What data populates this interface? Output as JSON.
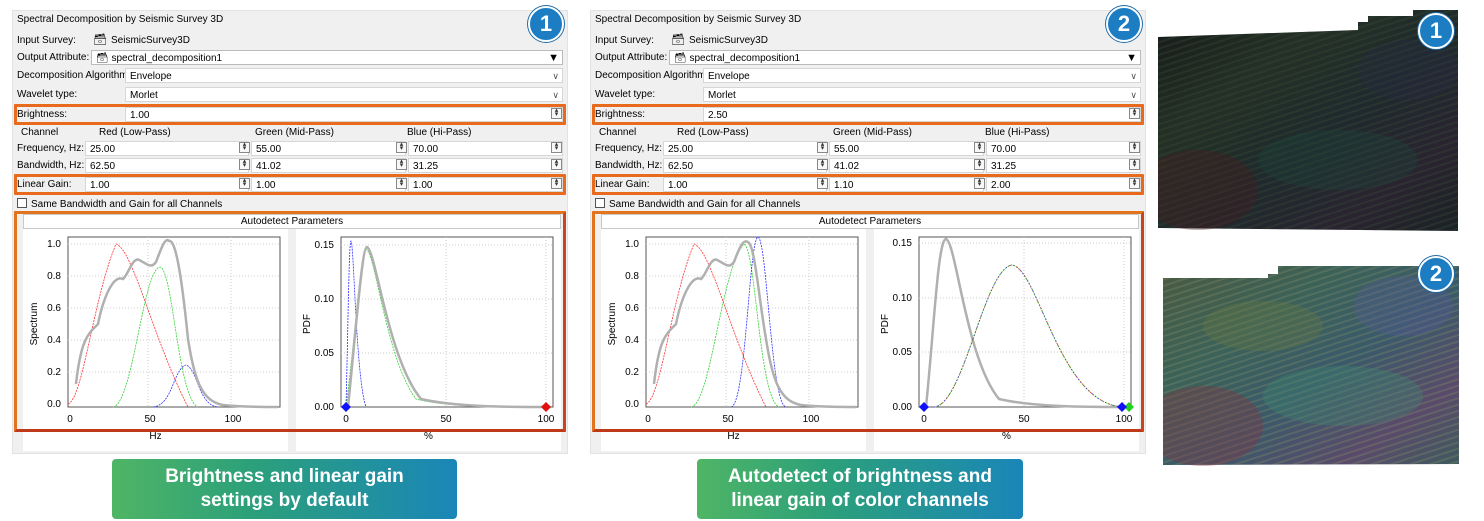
{
  "panels": [
    {
      "title": "Spectral Decomposition by Seismic Survey 3D",
      "badge": "1",
      "input_survey_label": "Input Survey:",
      "input_survey_value": "SeismicSurvey3D",
      "output_attr_label": "Output Attribute:",
      "output_attr_value": "spectral_decomposition1",
      "algo_label": "Decomposition Algorithm:",
      "algo_value": "Envelope",
      "wavelet_label": "Wavelet type:",
      "wavelet_value": "Morlet",
      "brightness_label": "Brightness:",
      "brightness_value": "1.00",
      "channel_hdr": "Channel",
      "red_hdr": "Red (Low-Pass)",
      "green_hdr": "Green (Mid-Pass)",
      "blue_hdr": "Blue (Hi-Pass)",
      "freq_label": "Frequency, Hz:",
      "freq": [
        "25.00",
        "55.00",
        "70.00"
      ],
      "bw_label": "Bandwidth, Hz:",
      "bw": [
        "62.50",
        "41.02",
        "31.25"
      ],
      "gain_label": "Linear Gain:",
      "gain": [
        "1.00",
        "1.00",
        "1.00"
      ],
      "same_bw_label": "Same Bandwidth and Gain for all Channels",
      "autodetect_label": "Autodetect Parameters",
      "spectrum_ylabel": "Spectrum",
      "spectrum_xlabel": "Hz",
      "spectrum_yticks": [
        "1.0",
        "0.8",
        "0.6",
        "0.4",
        "0.2",
        "0.0"
      ],
      "spectrum_xticks": [
        "0",
        "50",
        "100"
      ],
      "pdf_ylabel": "PDF",
      "pdf_xlabel": "%",
      "pdf_yticks": [
        "0.15",
        "0.10",
        "0.05",
        "0.00"
      ],
      "pdf_xticks": [
        "0",
        "50",
        "100"
      ],
      "banner": [
        "Brightness and linear gain",
        "settings by default"
      ]
    },
    {
      "title": "Spectral Decomposition by Seismic Survey 3D",
      "badge": "2",
      "input_survey_label": "Input Survey:",
      "input_survey_value": "SeismicSurvey3D",
      "output_attr_label": "Output Attribute:",
      "output_attr_value": "spectral_decomposition1",
      "algo_label": "Decomposition Algorithm:",
      "algo_value": "Envelope",
      "wavelet_label": "Wavelet type:",
      "wavelet_value": "Morlet",
      "brightness_label": "Brightness:",
      "brightness_value": "2.50",
      "channel_hdr": "Channel",
      "red_hdr": "Red (Low-Pass)",
      "green_hdr": "Green (Mid-Pass)",
      "blue_hdr": "Blue (Hi-Pass)",
      "freq_label": "Frequency, Hz:",
      "freq": [
        "25.00",
        "55.00",
        "70.00"
      ],
      "bw_label": "Bandwidth, Hz:",
      "bw": [
        "62.50",
        "41.02",
        "31.25"
      ],
      "gain_label": "Linear Gain:",
      "gain": [
        "1.00",
        "1.10",
        "2.00"
      ],
      "same_bw_label": "Same Bandwidth and Gain for all Channels",
      "autodetect_label": "Autodetect Parameters",
      "spectrum_ylabel": "Spectrum",
      "spectrum_xlabel": "Hz",
      "spectrum_yticks": [
        "1.0",
        "0.8",
        "0.6",
        "0.4",
        "0.2",
        "0.0"
      ],
      "spectrum_xticks": [
        "0",
        "50",
        "100"
      ],
      "pdf_ylabel": "PDF",
      "pdf_xlabel": "%",
      "pdf_yticks": [
        "0.15",
        "0.10",
        "0.05",
        "0.00"
      ],
      "pdf_xticks": [
        "0",
        "50",
        "100"
      ],
      "banner": [
        "Autodetect of brightness and",
        "linear gain of color channels"
      ]
    }
  ],
  "seismic_badges": [
    "1",
    "2"
  ],
  "colors": {
    "highlight_orange": "#e86a1c",
    "badge_blue": "#1c7dc3",
    "banner_green": "#4fb565",
    "banner_blue": "#1a86b8",
    "red_channel": "#ff3030",
    "green_channel": "#30d030",
    "blue_channel": "#3030ff",
    "total_spectrum": "#b0b0b0"
  }
}
